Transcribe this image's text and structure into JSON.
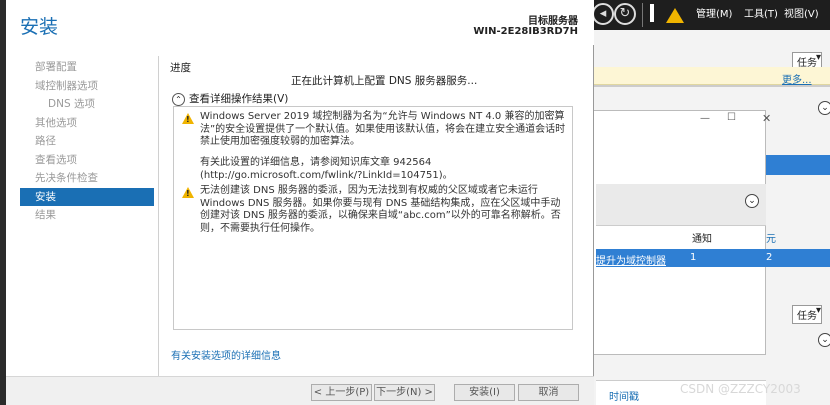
{
  "wizard": {
    "title": "安装",
    "target_label": "目标服务器",
    "target_name": "WIN-2E28IB3RD7H",
    "nav": [
      {
        "label": "部署配置",
        "sub": false,
        "active": false
      },
      {
        "label": "域控制器选项",
        "sub": false,
        "active": false
      },
      {
        "label": "DNS 选项",
        "sub": true,
        "active": false
      },
      {
        "label": "其他选项",
        "sub": false,
        "active": false
      },
      {
        "label": "路径",
        "sub": false,
        "active": false
      },
      {
        "label": "查看选项",
        "sub": false,
        "active": false
      },
      {
        "label": "先决条件检查",
        "sub": false,
        "active": false
      },
      {
        "label": "安装",
        "sub": false,
        "active": true
      },
      {
        "label": "结果",
        "sub": false,
        "active": false
      }
    ],
    "section_title": "进度",
    "status_text": "正在此计算机上配置 DNS 服务器服务...",
    "details_toggle": "查看详细操作结果(V)",
    "messages": [
      {
        "icon": "warning-icon",
        "text": "Windows Server 2019 域控制器为名为“允许与 Windows NT 4.0 兼容的加密算法”的安全设置提供了一个默认值。如果使用该默认值，将会在建立安全通道会话时禁止使用加密强度较弱的加密算法。"
      },
      {
        "icon": "",
        "text": "有关此设置的详细信息，请参阅知识库文章 942564 (http://go.microsoft.com/fwlink/?LinkId=104751)。"
      },
      {
        "icon": "warning-icon",
        "text": "无法创建该 DNS 服务器的委派，因为无法找到有权威的父区域或者它未运行 Windows DNS 服务器。如果你要与现有 DNS 基础结构集成，应在父区域中手动创建对该 DNS 服务器的委派，以确保来自域“abc.com”以外的可靠名称解析。否则，不需要执行任何操作。"
      }
    ],
    "more_link": "有关安装选项的详细信息",
    "buttons": {
      "prev": "< 上一步(P)",
      "next": "下一步(N) >",
      "install": "安装(I)",
      "cancel": "取消"
    }
  },
  "server_manager": {
    "menu": [
      "管理(M)",
      "工具(T)",
      "视图(V)"
    ],
    "task_label": "任务",
    "more_label": "更多...",
    "col_notify": "通知",
    "promote_link": "提升为域控制器",
    "notify_count": "1",
    "timestamp_label": "时间戳"
  },
  "watermark": "CSDN @ZZZCY2003"
}
